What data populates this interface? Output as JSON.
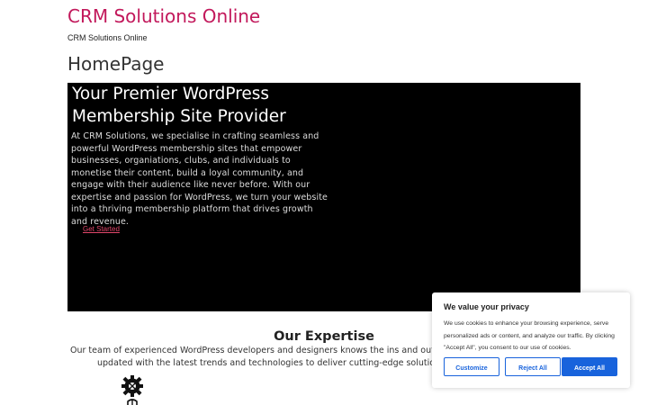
{
  "header": {
    "site_title": "CRM Solutions Online",
    "tagline": "CRM Solutions Online"
  },
  "page": {
    "title": "HomePage"
  },
  "hero": {
    "heading": "Your Premier WordPress Membership Site Provider",
    "body": "At CRM Solutions, we specialise in crafting seamless and powerful WordPress membership sites that empower businesses, organiations, clubs, and individuals to monetise their content, build a loyal community, and engage with their audience like never before. With our expertise and passion for WordPress, we turn your website into a thriving membership platform that drives growth and revenue.",
    "cta_label": "Get Started"
  },
  "expertise": {
    "title": "Our Expertise",
    "text_line1": "Our team of experienced WordPress developers and designers knows the ins and outs of",
    "text_line2": "updated with the latest trends and technologies to deliver cutting-edge solutions t",
    "icon": "gear-icon"
  },
  "cookie_banner": {
    "title": "We value your privacy",
    "text": "We use cookies to enhance your browsing experience, serve personalized ads or content, and analyze our traffic. By clicking \"Accept All\", you consent to our use of cookies.",
    "customize_label": "Customize",
    "reject_label": "Reject All",
    "accept_label": "Accept All",
    "accent_color": "#1863dc"
  },
  "colors": {
    "site_title": "#c2185b",
    "hero_bg": "#000000",
    "cta_link": "#e2476b"
  }
}
